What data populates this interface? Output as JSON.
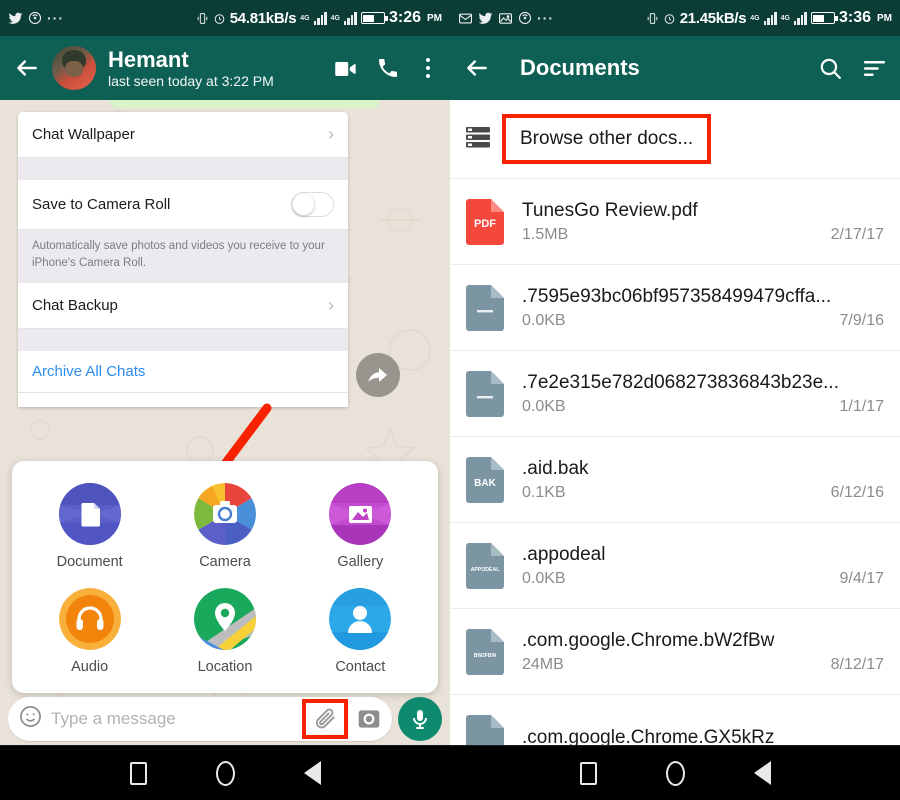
{
  "left": {
    "statusbar": {
      "icons": [
        "twitter-icon",
        "cast-icon",
        "more-dots-icon"
      ],
      "network_speed": "54.81kB/s",
      "sim1_label": "4G",
      "sim2_label": "4G",
      "time": "3:26",
      "ampm": "PM"
    },
    "appbar": {
      "back_icon": "back-arrow-icon",
      "contact_name": "Hemant",
      "contact_status": "last seen today at 3:22 PM",
      "video_call_icon": "video-call-icon",
      "voice_call_icon": "phone-icon",
      "overflow_icon": "kebab-menu-icon"
    },
    "settings_card": {
      "rows": [
        {
          "label": "Chat Wallpaper",
          "type": "chevron"
        },
        {
          "label": "Save to Camera Roll",
          "type": "toggle",
          "toggle_on": false
        },
        {
          "label": "Chat Backup",
          "type": "chevron"
        }
      ],
      "note": "Automatically save photos and videos you receive to your iPhone's Camera Roll.",
      "link": "Archive All Chats"
    },
    "forward_icon": "forward-arrow-icon",
    "attachment_sheet": {
      "items": [
        {
          "label": "Document",
          "icon": "document-icon",
          "color": "#5a5fc7"
        },
        {
          "label": "Camera",
          "icon": "camera-icon",
          "color": "#f2a03d"
        },
        {
          "label": "Gallery",
          "icon": "gallery-icon",
          "color": "#bf43c6"
        },
        {
          "label": "Audio",
          "icon": "headphones-icon",
          "color": "#f6a623"
        },
        {
          "label": "Location",
          "icon": "location-pin-icon",
          "color": "#1aa85c"
        },
        {
          "label": "Contact",
          "icon": "person-icon",
          "color": "#2aa8e8"
        }
      ]
    },
    "input_bar": {
      "emoji_icon": "emoji-smiley-icon",
      "placeholder": "Type a message",
      "attach_icon": "paperclip-icon",
      "camera_icon": "camera-shutter-icon",
      "mic_icon": "microphone-icon"
    }
  },
  "right": {
    "statusbar": {
      "icons": [
        "gmail-icon",
        "twitter-icon",
        "photo-icon",
        "cast-icon",
        "more-dots-icon"
      ],
      "network_speed": "21.45kB/s",
      "sim1_label": "4G",
      "sim2_label": "4G",
      "time": "3:36",
      "ampm": "PM"
    },
    "appbar": {
      "back_icon": "back-arrow-icon",
      "title": "Documents",
      "search_icon": "search-icon",
      "sort_icon": "sort-icon"
    },
    "browse": {
      "icon": "storage-list-icon",
      "label": "Browse other docs..."
    },
    "documents": [
      {
        "name": "TunesGo Review.pdf",
        "size": "1.5MB",
        "date": "2/17/17",
        "badge": "PDF",
        "icon_color": "#f4483c",
        "badge_color": "#ffffff"
      },
      {
        "name": ".7595e93bc06bf957358499479cffa...",
        "size": "0.0KB",
        "date": "7/9/16",
        "badge": "",
        "icon_color": "#7b95a3",
        "badge_color": "#ffffff"
      },
      {
        "name": ".7e2e315e782d068273836843b23e...",
        "size": "0.0KB",
        "date": "1/1/17",
        "badge": "",
        "icon_color": "#7b95a3",
        "badge_color": "#ffffff"
      },
      {
        "name": ".aid.bak",
        "size": "0.1KB",
        "date": "6/12/16",
        "badge": "BAK",
        "icon_color": "#7b95a3",
        "badge_color": "#ffffff"
      },
      {
        "name": ".appodeal",
        "size": "0.0KB",
        "date": "9/4/17",
        "badge": "APPODEAL",
        "icon_color": "#7b95a3",
        "badge_color": "#ffffff"
      },
      {
        "name": ".com.google.Chrome.bW2fBw",
        "size": "24MB",
        "date": "8/12/17",
        "badge": "BW2FBW",
        "icon_color": "#7b95a3",
        "badge_color": "#ffffff"
      },
      {
        "name": ".com.google.Chrome.GX5kRz",
        "size": "",
        "date": "",
        "badge": "",
        "icon_color": "#7b95a3",
        "badge_color": "#ffffff"
      }
    ]
  },
  "navbar": {
    "buttons": [
      "recents-button",
      "home-button",
      "back-button"
    ]
  },
  "annotations": {
    "arrow_color": "#f62200",
    "highlight_color": "#f62200"
  },
  "colors": {
    "appbar_teal": "#0f6054",
    "statusbar_teal": "#0b3d36",
    "chat_bg": "#e8e2d9",
    "accent_blue": "#2d8cf0",
    "mic_green": "#0f8a6e"
  }
}
